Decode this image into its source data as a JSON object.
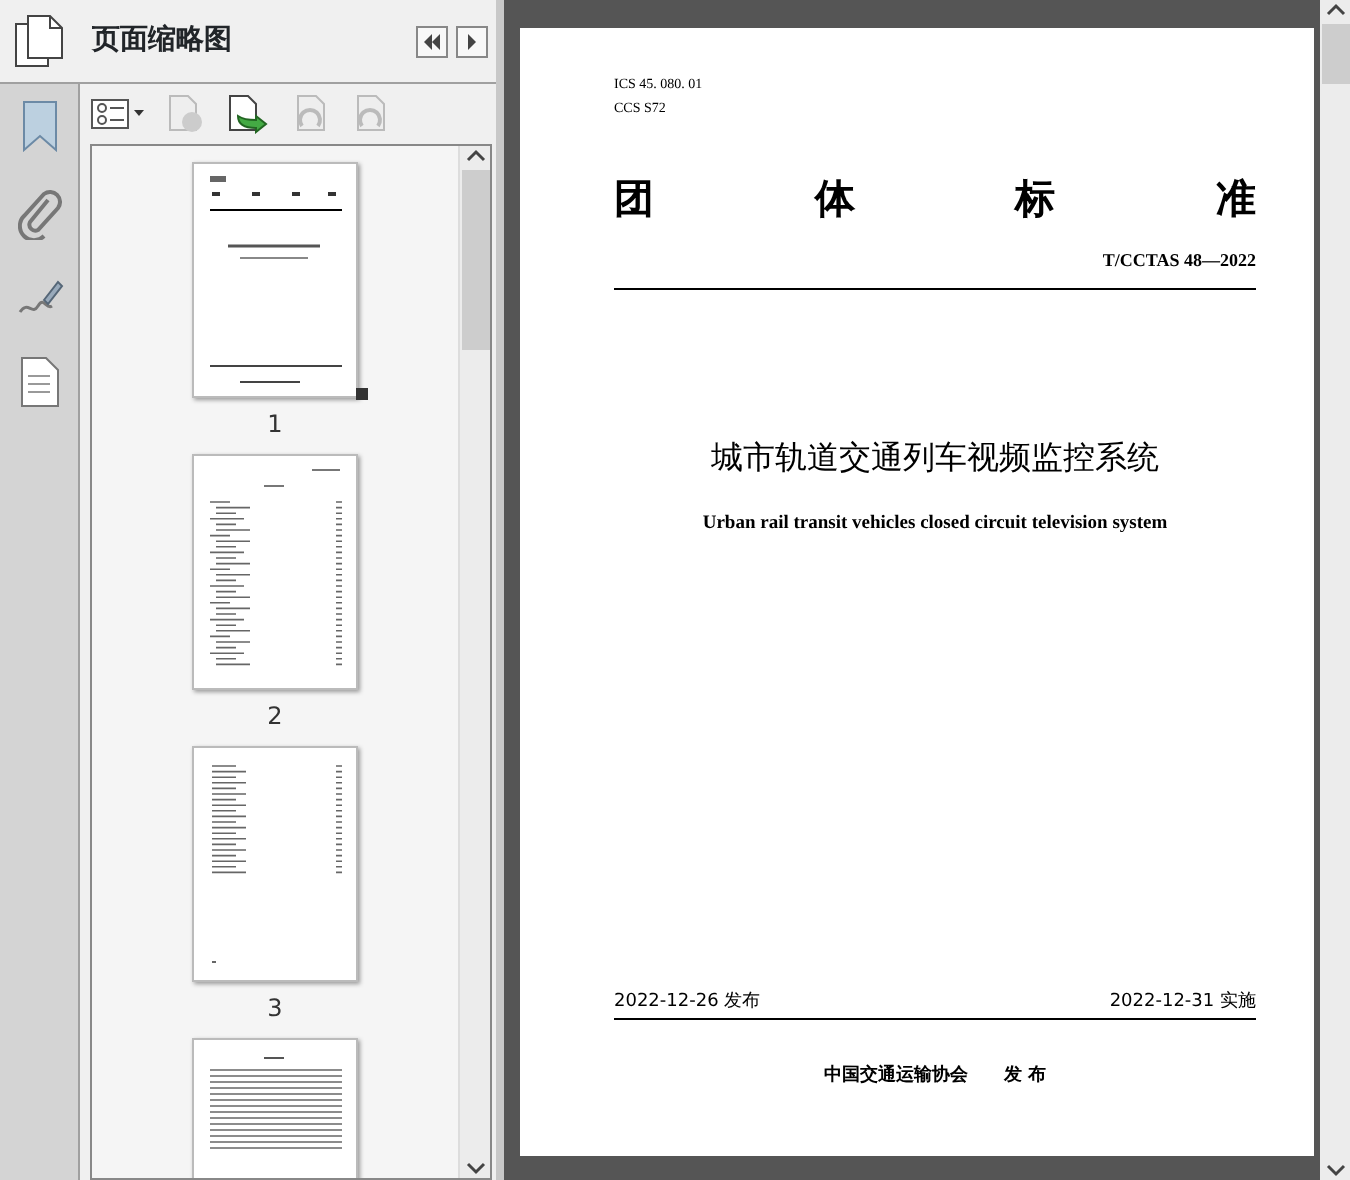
{
  "panel": {
    "title": "页面缩略图"
  },
  "thumbnails": [
    {
      "label": "1",
      "kind": "cover",
      "current": true
    },
    {
      "label": "2",
      "kind": "toc",
      "current": false
    },
    {
      "label": "3",
      "kind": "list",
      "current": false
    },
    {
      "kind": "text",
      "current": false
    }
  ],
  "document": {
    "ics": "ICS 45. 080. 01",
    "ccs": "CCS  S72",
    "heading": [
      "团",
      "体",
      "标",
      "准"
    ],
    "standard_number": "T/CCTAS 48—2022",
    "title": "城市轨道交通列车视频监控系统",
    "english_title": "Urban rail transit vehicles closed circuit television system",
    "publish_date": "2022-12-26 发布",
    "implement_date": "2022-12-31 实施",
    "publisher": "中国交通运输协会",
    "publish_word": "发 布"
  }
}
